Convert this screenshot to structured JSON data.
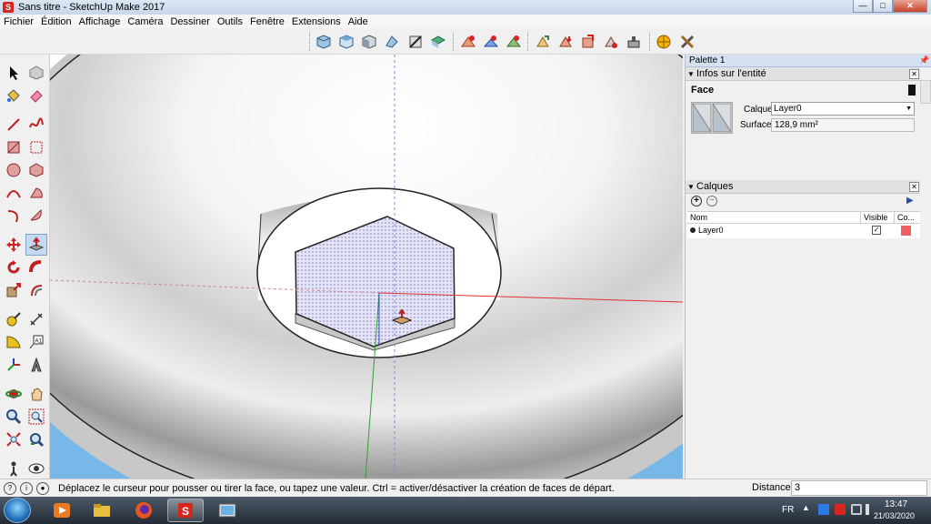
{
  "window": {
    "title": "Sans titre - SketchUp Make 2017",
    "app_icon": "sketchup-icon",
    "min_glyph": "—",
    "max_glyph": "□",
    "close_glyph": "✕"
  },
  "menu": [
    "Fichier",
    "Édition",
    "Affichage",
    "Caméra",
    "Dessiner",
    "Outils",
    "Fenêtre",
    "Extensions",
    "Aide"
  ],
  "toolbar_top": {
    "icons": [
      "iso-view-icon",
      "top-view-icon",
      "front-view-icon",
      "right-view-icon",
      "section-plane-icon",
      "display-section-icon",
      "add-location-icon",
      "toggle-terrain-icon",
      "photo-textures-icon",
      "share-model-icon",
      "get-models-icon",
      "share-component-icon",
      "warehouse-icon",
      "extension-icon",
      "geo-icon",
      "tools-icon"
    ]
  },
  "toolbar_left": {
    "icons": [
      "select-icon",
      "make-component-icon",
      "paint-bucket-icon",
      "eraser-icon",
      "line-icon",
      "freehand-icon",
      "rectangle-icon",
      "rotated-rectangle-icon",
      "circle-icon",
      "polygon-icon",
      "arc-icon",
      "pie-icon",
      "two-point-arc-icon",
      "three-point-arc-icon",
      "move-icon",
      "push-pull-icon",
      "rotate-icon",
      "follow-me-icon",
      "scale-icon",
      "offset-icon",
      "tape-measure-icon",
      "dimension-icon",
      "protractor-icon",
      "text-icon",
      "axes-icon",
      "3d-text-icon",
      "orbit-icon",
      "pan-icon",
      "zoom-icon",
      "zoom-window-icon",
      "zoom-extents-icon",
      "previous-view-icon",
      "position-camera-icon",
      "look-around-icon"
    ],
    "active": "push-pull-icon"
  },
  "tray": {
    "title": "Palette 1",
    "entity_info": {
      "header": "Infos sur l'entité",
      "entity_type": "Face",
      "layer_label": "Calque:",
      "layer_value": "Layer0",
      "area_label": "Surface:",
      "area_value": "128,9 mm²"
    },
    "layers": {
      "header": "Calques",
      "col_name": "Nom",
      "col_visible": "Visible",
      "col_color": "Co...",
      "rows": [
        {
          "name": "Layer0",
          "visible": true,
          "color": "#f06060"
        }
      ]
    }
  },
  "status": {
    "message": "Déplacez le curseur pour pousser ou tirer la face, ou tapez une valeur.  Ctrl = activer/désactiver la création de faces de départ.",
    "distance_label": "Distance",
    "distance_value": "3"
  },
  "taskbar": {
    "language": "FR",
    "time": "13:47",
    "date": "21/03/2020",
    "apps": [
      "media-player-icon",
      "file-explorer-icon",
      "firefox-icon",
      "sketchup-icon",
      "photo-viewer-icon"
    ],
    "active_app": "sketchup-icon"
  },
  "colors": {
    "face_fill": "#d8d8f0",
    "sky_blue": "#78b8e8",
    "layer_color": "#f06060",
    "axis_red": "#e03030",
    "axis_green": "#30a030",
    "axis_blue": "#3050c0"
  }
}
